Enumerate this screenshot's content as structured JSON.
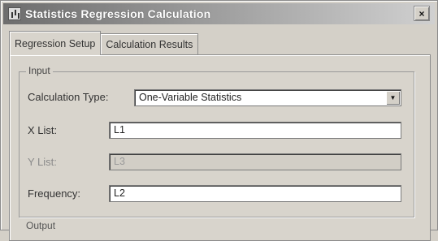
{
  "window": {
    "title": "Statistics Regression Calculation",
    "close_glyph": "×"
  },
  "tabs": [
    {
      "label": "Regression Setup",
      "active": true
    },
    {
      "label": "Calculation Results",
      "active": false
    }
  ],
  "input_group": {
    "label": "Input",
    "calculation_type": {
      "label": "Calculation Type:",
      "value": "One-Variable Statistics"
    },
    "x_list": {
      "label": "X List:",
      "value": "L1"
    },
    "y_list": {
      "label": "Y List:",
      "value": "L3",
      "enabled": false
    },
    "frequency": {
      "label": "Frequency:",
      "value": "L2"
    }
  },
  "output_group": {
    "label": "Output"
  }
}
